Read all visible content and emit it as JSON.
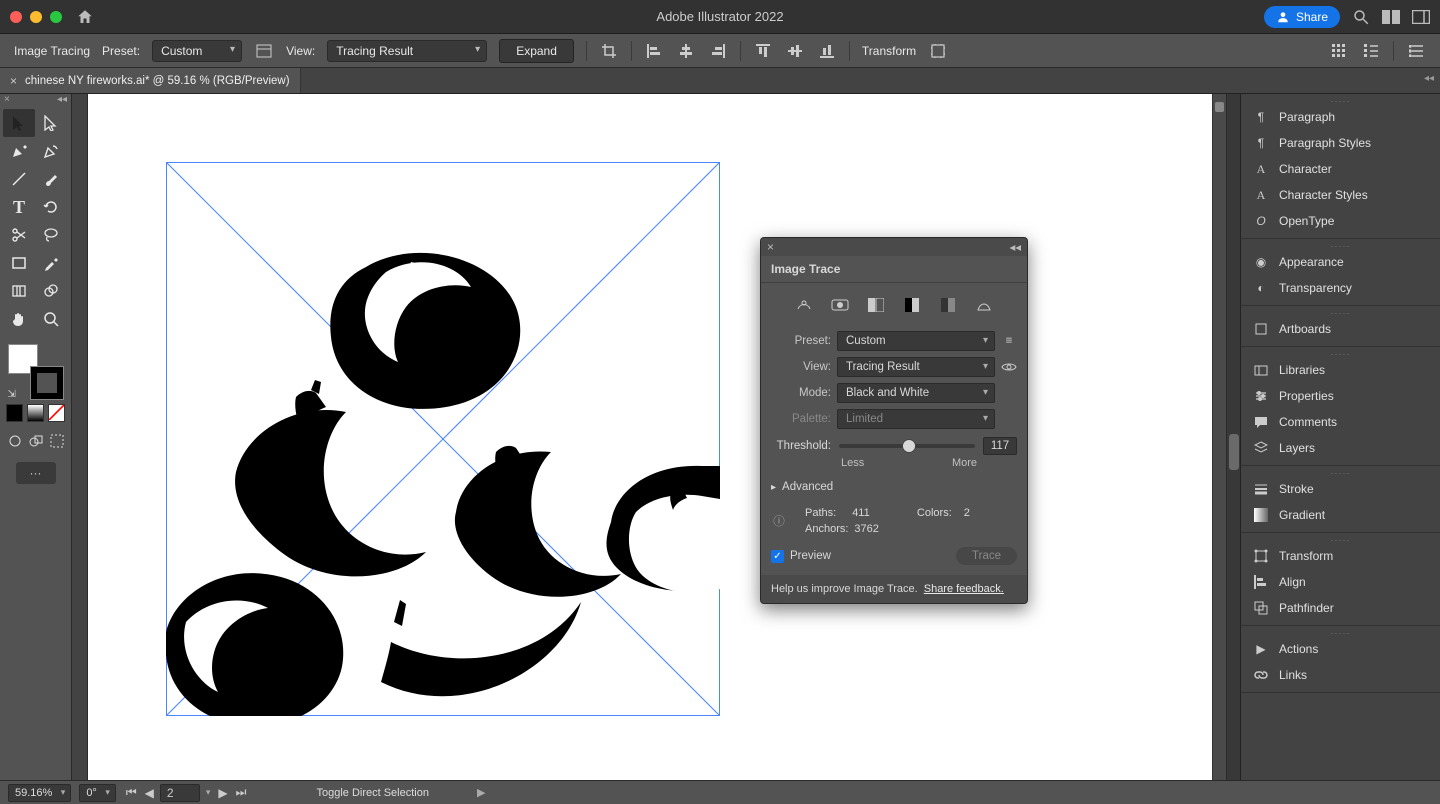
{
  "titlebar": {
    "title": "Adobe Illustrator 2022",
    "share_label": "Share"
  },
  "controlbar": {
    "mode_label": "Image Tracing",
    "preset_label": "Preset:",
    "preset_value": "Custom",
    "view_label": "View:",
    "view_value": "Tracing Result",
    "expand_label": "Expand",
    "transform_label": "Transform"
  },
  "tab": {
    "title": "chinese NY fireworks.ai* @ 59.16 % (RGB/Preview)"
  },
  "image_trace": {
    "panel_title": "Image Trace",
    "preset_label": "Preset:",
    "preset_value": "Custom",
    "view_label": "View:",
    "view_value": "Tracing Result",
    "mode_label": "Mode:",
    "mode_value": "Black and White",
    "palette_label": "Palette:",
    "palette_value": "Limited",
    "threshold_label": "Threshold:",
    "threshold_value": "117",
    "threshold_percent": 46,
    "less_label": "Less",
    "more_label": "More",
    "advanced_label": "Advanced",
    "paths_label": "Paths:",
    "paths_value": "411",
    "colors_label": "Colors:",
    "colors_value": "2",
    "anchors_label": "Anchors:",
    "anchors_value": "3762",
    "preview_label": "Preview",
    "trace_label": "Trace",
    "help_text": "Help us improve Image Trace.",
    "feedback_link": "Share feedback."
  },
  "right_panels": {
    "g1": [
      "Paragraph",
      "Paragraph Styles",
      "Character",
      "Character Styles",
      "OpenType"
    ],
    "g2": [
      "Appearance",
      "Transparency"
    ],
    "g3": [
      "Artboards"
    ],
    "g4": [
      "Libraries",
      "Properties",
      "Comments",
      "Layers"
    ],
    "g5": [
      "Stroke",
      "Gradient"
    ],
    "g6": [
      "Transform",
      "Align",
      "Pathfinder"
    ],
    "g7": [
      "Actions",
      "Links"
    ]
  },
  "status": {
    "zoom": "59.16%",
    "rotation": "0°",
    "page": "2",
    "hint": "Toggle Direct Selection"
  }
}
